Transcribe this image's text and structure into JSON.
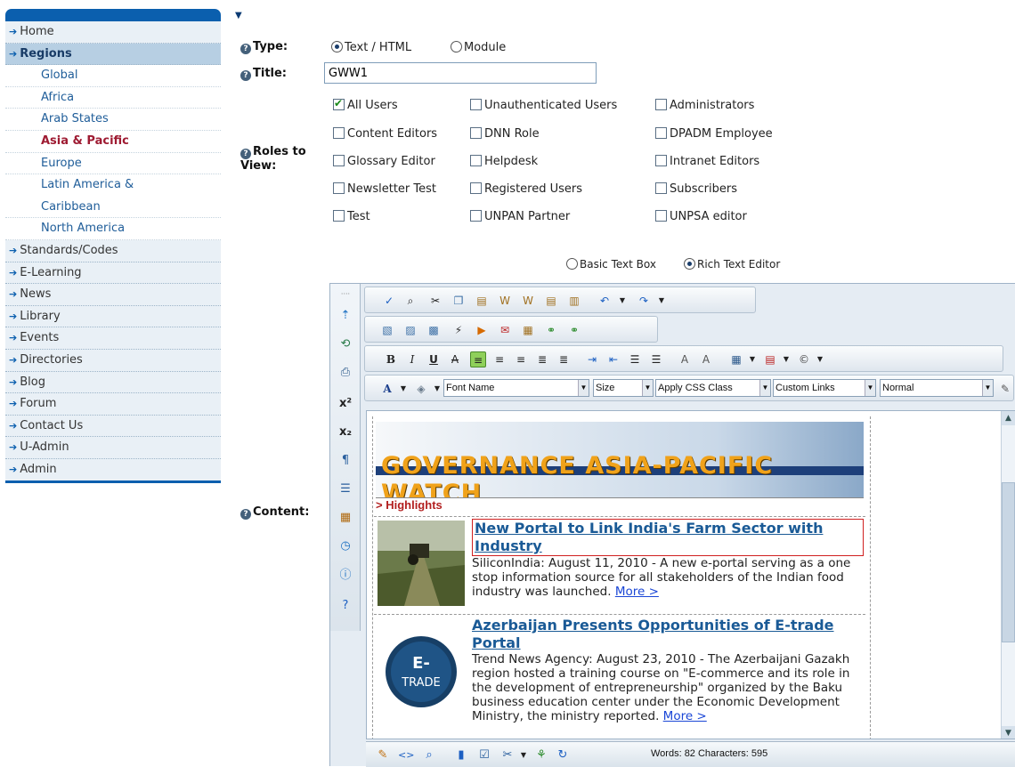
{
  "sidebar": {
    "items": [
      {
        "label": "Home"
      },
      {
        "label": "Regions"
      }
    ],
    "subitems": [
      {
        "label": "Global"
      },
      {
        "label": "Africa"
      },
      {
        "label": "Arab States"
      },
      {
        "label": "Asia & Pacific"
      },
      {
        "label": "Europe"
      },
      {
        "label": "Latin America &"
      },
      {
        "label": "Caribbean"
      },
      {
        "label": "North America"
      }
    ],
    "items_after": [
      {
        "label": "Standards/Codes"
      },
      {
        "label": "E-Learning"
      },
      {
        "label": "News"
      },
      {
        "label": "Library"
      },
      {
        "label": "Events"
      },
      {
        "label": "Directories"
      },
      {
        "label": "Blog"
      },
      {
        "label": "Forum"
      },
      {
        "label": "Contact Us"
      },
      {
        "label": "U-Admin"
      },
      {
        "label": "Admin"
      }
    ]
  },
  "form": {
    "type_label": "Type:",
    "type_options": [
      "Text / HTML",
      "Module"
    ],
    "title_label": "Title:",
    "title_value": "GWW1",
    "roles_label_1": "Roles to",
    "roles_label_2": "View:",
    "roles": [
      [
        "All Users",
        "Unauthenticated Users",
        "Administrators"
      ],
      [
        "Content Editors",
        "DNN Role",
        "DPADM Employee"
      ],
      [
        "Glossary Editor",
        "Helpdesk",
        "Intranet Editors"
      ],
      [
        "Newsletter Test",
        "Registered Users",
        "Subscribers"
      ],
      [
        "Test",
        "UNPAN Partner",
        "UNPSA editor"
      ]
    ],
    "editor_mode_options": [
      "Basic Text Box",
      "Rich Text Editor"
    ],
    "content_label": "Content:"
  },
  "editor": {
    "selects": {
      "font_name": "Font Name",
      "size": "Size",
      "css_class": "Apply CSS Class",
      "links": "Custom Links",
      "paragraph": "Normal"
    },
    "banner_title": "GOVERNANCE  ASIA-PACIFIC  WATCH",
    "highlights": "> Highlights",
    "stories": [
      {
        "headline": "New Portal to Link India's Farm Sector with Industry",
        "body": "SiliconIndia: August 11, 2010 -  A new e-portal serving as a one stop information source for all stakeholders of the Indian food industry was launched.",
        "more": "More >"
      },
      {
        "headline": "Azerbaijan Presents Opportunities of E-trade Portal",
        "body": "Trend News Agency: August 23, 2010 - The Azerbaijani Gazakh region hosted a training course on \"E-commerce and its role in the development of entrepreneurship\" organized by the Baku business education center under the Economic Development Ministry, the ministry reported.",
        "more": "More >",
        "thumb_text_1": "E-",
        "thumb_text_2": "TRADE"
      }
    ],
    "word_count": "Words: 82 Characters: 595"
  }
}
